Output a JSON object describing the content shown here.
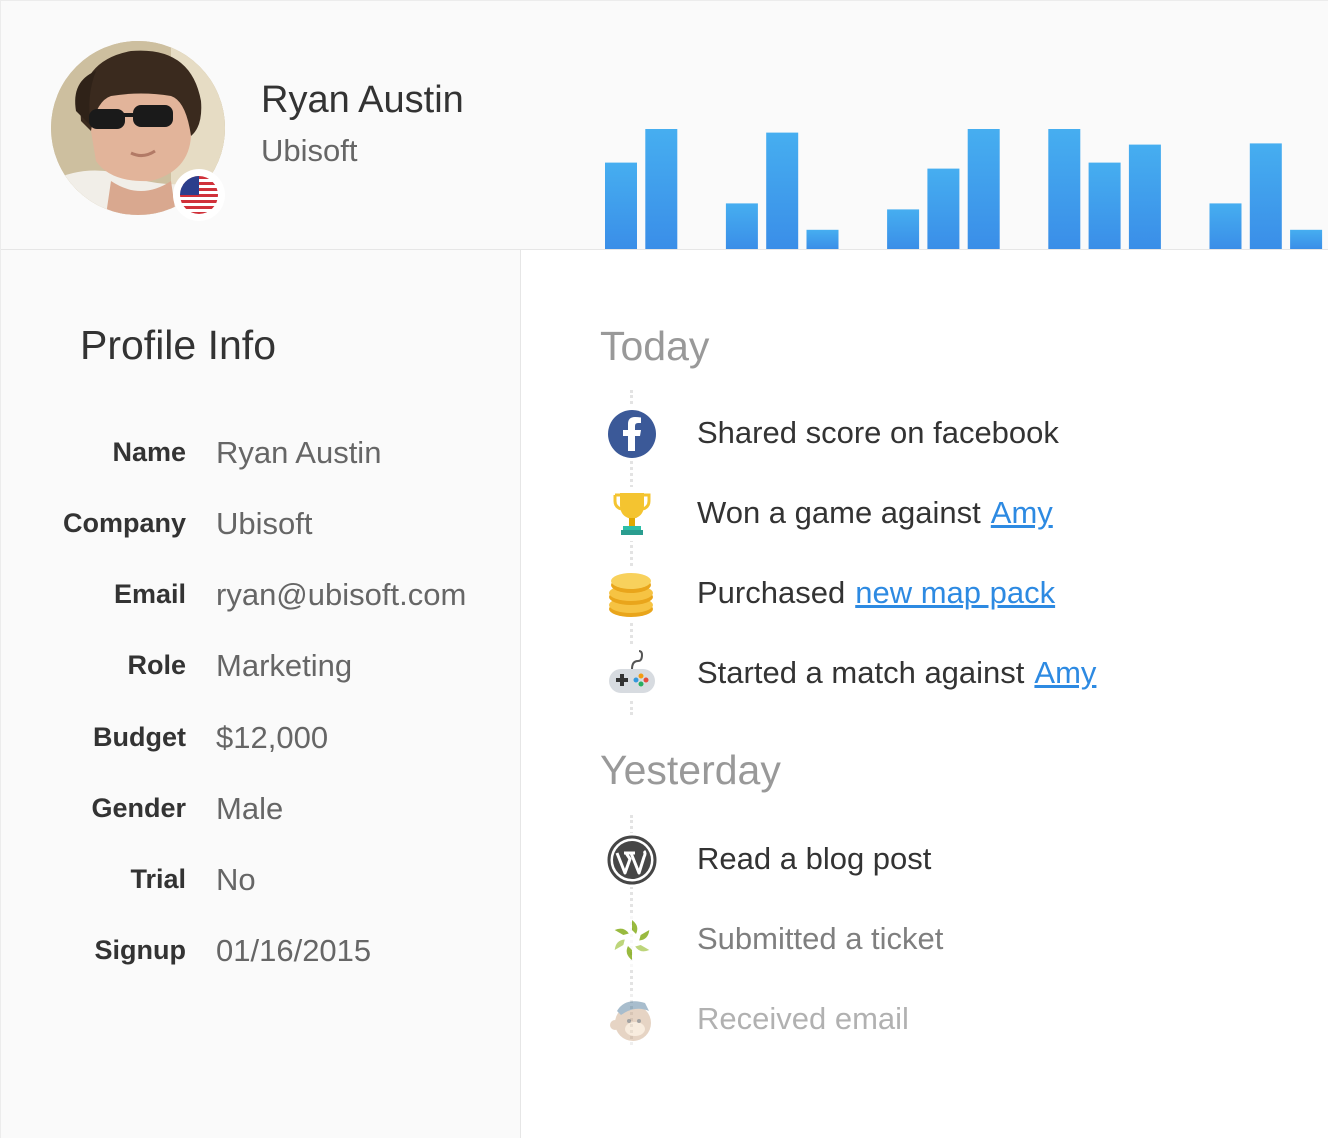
{
  "user": {
    "name": "Ryan Austin",
    "company": "Ubisoft",
    "flag_icon": "us-flag-icon"
  },
  "header_chart": {
    "type": "bar",
    "values": [
      72,
      100,
      null,
      38,
      97,
      16,
      null,
      33,
      67,
      100,
      null,
      100,
      72,
      87,
      null,
      38,
      88,
      16
    ],
    "color": "#3b97e6",
    "color_top": "#46aef0"
  },
  "profile": {
    "title": "Profile Info",
    "rows": [
      {
        "label": "Name",
        "value": "Ryan Austin"
      },
      {
        "label": "Company",
        "value": "Ubisoft"
      },
      {
        "label": "Email",
        "value": "ryan@ubisoft.com"
      },
      {
        "label": "Role",
        "value": "Marketing"
      },
      {
        "label": "Budget",
        "value": "$12,000"
      },
      {
        "label": "Gender",
        "value": "Male"
      },
      {
        "label": "Trial",
        "value": "No"
      },
      {
        "label": "Signup",
        "value": "01/16/2015"
      }
    ]
  },
  "timeline": {
    "today_label": "Today",
    "yesterday_label": "Yesterday",
    "today": [
      {
        "icon": "facebook-icon",
        "text": "Shared score on facebook",
        "link": ""
      },
      {
        "icon": "trophy-icon",
        "text": "Won a game against",
        "link": "Amy"
      },
      {
        "icon": "coins-icon",
        "text": "Purchased",
        "link": "new map pack"
      },
      {
        "icon": "gamepad-icon",
        "text": "Started a match against",
        "link": "Amy"
      }
    ],
    "yesterday": [
      {
        "icon": "wordpress-icon",
        "text": "Read a blog post",
        "link": ""
      },
      {
        "icon": "zendesk-icon",
        "text": "Submitted a ticket",
        "link": ""
      },
      {
        "icon": "mailchimp-icon",
        "text": "Received email",
        "link": ""
      }
    ]
  },
  "colors": {
    "link": "#2d8ae2",
    "facebook": "#3b5998",
    "bar": "#3b97e6"
  }
}
